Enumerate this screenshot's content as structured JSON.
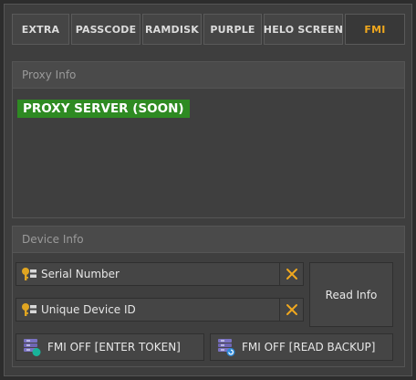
{
  "tabs": [
    {
      "label": "EXTRA",
      "active": false
    },
    {
      "label": "PASSCODE",
      "active": false
    },
    {
      "label": "RAMDISK",
      "active": false
    },
    {
      "label": "PURPLE",
      "active": false
    },
    {
      "label": "HELO SCREEN",
      "active": false
    },
    {
      "label": "FMI",
      "active": true
    }
  ],
  "proxy_panel": {
    "title": "Proxy Info",
    "status_label": "PROXY SERVER (SOON)"
  },
  "device_panel": {
    "title": "Device Info",
    "serial_field": {
      "value": "Serial Number",
      "icon": "key-icon",
      "clear_icon": "close-icon"
    },
    "udid_field": {
      "value": "Unique Device ID",
      "icon": "key-icon",
      "clear_icon": "close-icon"
    },
    "read_info_label": "Read Info",
    "fmi_token_label": "FMI OFF [ENTER TOKEN]",
    "fmi_backup_label": "FMI OFF [READ BACKUP]"
  },
  "colors": {
    "accent": "#f0a81e",
    "status_green": "#2e8a22",
    "icon_blue": "#2f8ad8",
    "icon_teal": "#19b39a",
    "icon_purple": "#6f66b4"
  }
}
